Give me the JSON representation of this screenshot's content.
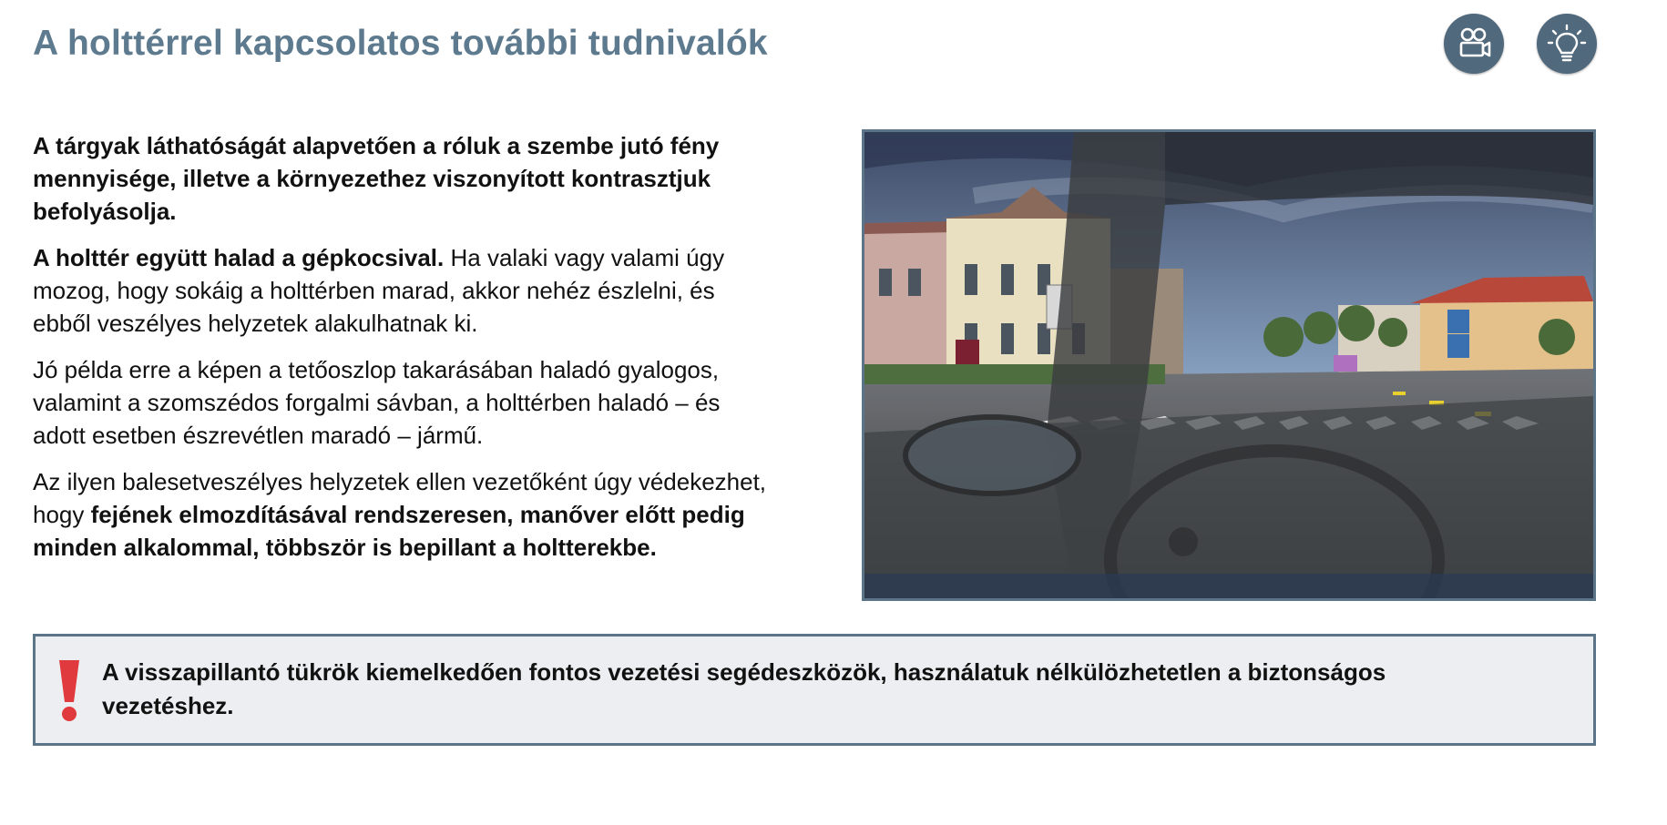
{
  "header": {
    "title": "A holttérrel kapcsolatos további tudnivalók",
    "icons": [
      "video-camera-icon",
      "lightbulb-icon"
    ]
  },
  "content": {
    "p1": "A tárgyak láthatóságát alapvetően a róluk a szembe jutó fény mennyisége, illetve a környezethez viszonyított kontrasztjuk befolyásolja.",
    "p2_bold": "A holttér együtt halad a gépkocsival.",
    "p2_rest": " Ha valaki vagy valami úgy mozog, hogy sokáig a holttérben marad, akkor nehéz észlelni, és ebből veszélyes helyzetek alakulhatnak ki.",
    "p3": "Jó példa erre a képen a tetőoszlop takarásában haladó gyalogos, valamint a szomszédos forgalmi sávban, a holttérben haladó – és adott esetben észrevétlen maradó – jármű.",
    "p4_start": "Az ilyen balesetveszélyes helyzetek ellen vezetőként úgy védekezhet, hogy ",
    "p4_bold": "fejének elmozdításával rendszeresen, manőver előtt pedig minden alkalommal, többször is bepillant a holtterekbe."
  },
  "alert": {
    "icon": "exclamation-icon",
    "text": "A visszapillantó tükrök kiemelkedően fontos vezetési segédeszközök, használatuk nélkülözhetetlen a biztonságos vezetéshez."
  },
  "colors": {
    "title": "#5d7a8f",
    "icon_bg": "#51697c",
    "frame_border": "#5c7488",
    "alert_bg": "#edeef2",
    "alert_mark": "#e03a3e"
  }
}
